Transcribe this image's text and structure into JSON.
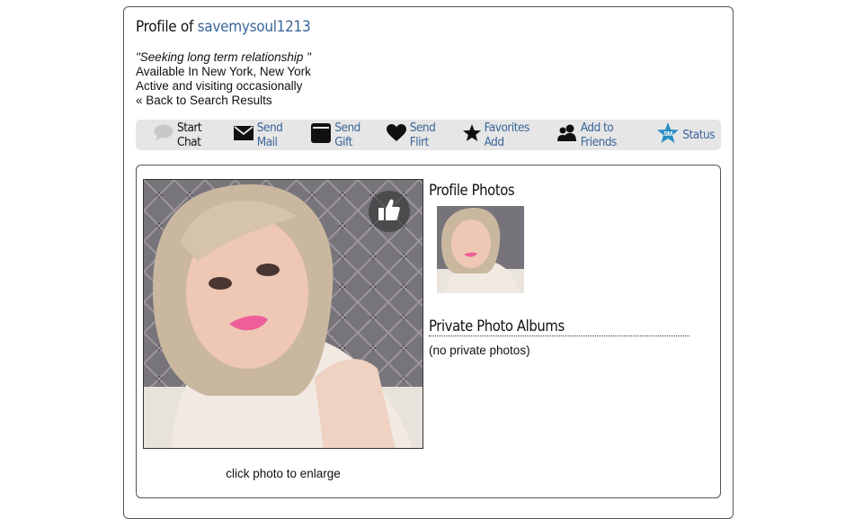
{
  "profile": {
    "title_prefix": "Profile of",
    "username": "savemysoul1213",
    "tagline": "\"Seeking long term relationship \"",
    "location": "Available In New York, New York",
    "activity": "Active and visiting occasionally",
    "back_link": "« Back to Search Results"
  },
  "actions": [
    {
      "label": "Start Chat",
      "icon": "chat-bubble-icon"
    },
    {
      "label": "Send Mail",
      "icon": "envelope-icon"
    },
    {
      "label": "Send Gift",
      "icon": "gift-box-icon"
    },
    {
      "label": "Send Flirt",
      "icon": "heart-icon"
    },
    {
      "label": "Favorites Add",
      "icon": "star-icon"
    },
    {
      "label": "Add to Friends",
      "icon": "friends-icon"
    },
    {
      "label": "Status",
      "icon": "sm-star-badge-icon",
      "badge_text": "SM"
    }
  ],
  "main_photo": {
    "caption": "click photo to enlarge",
    "like_icon": "thumbs-up-icon"
  },
  "profile_photos": {
    "title": "Profile Photos"
  },
  "private_albums": {
    "title": "Private Photo Albums",
    "empty_text": "(no private photos)"
  },
  "colors": {
    "link": "#3a6599",
    "action_bar_bg": "#e6e6e6",
    "status_badge": "#2a8fc4"
  }
}
